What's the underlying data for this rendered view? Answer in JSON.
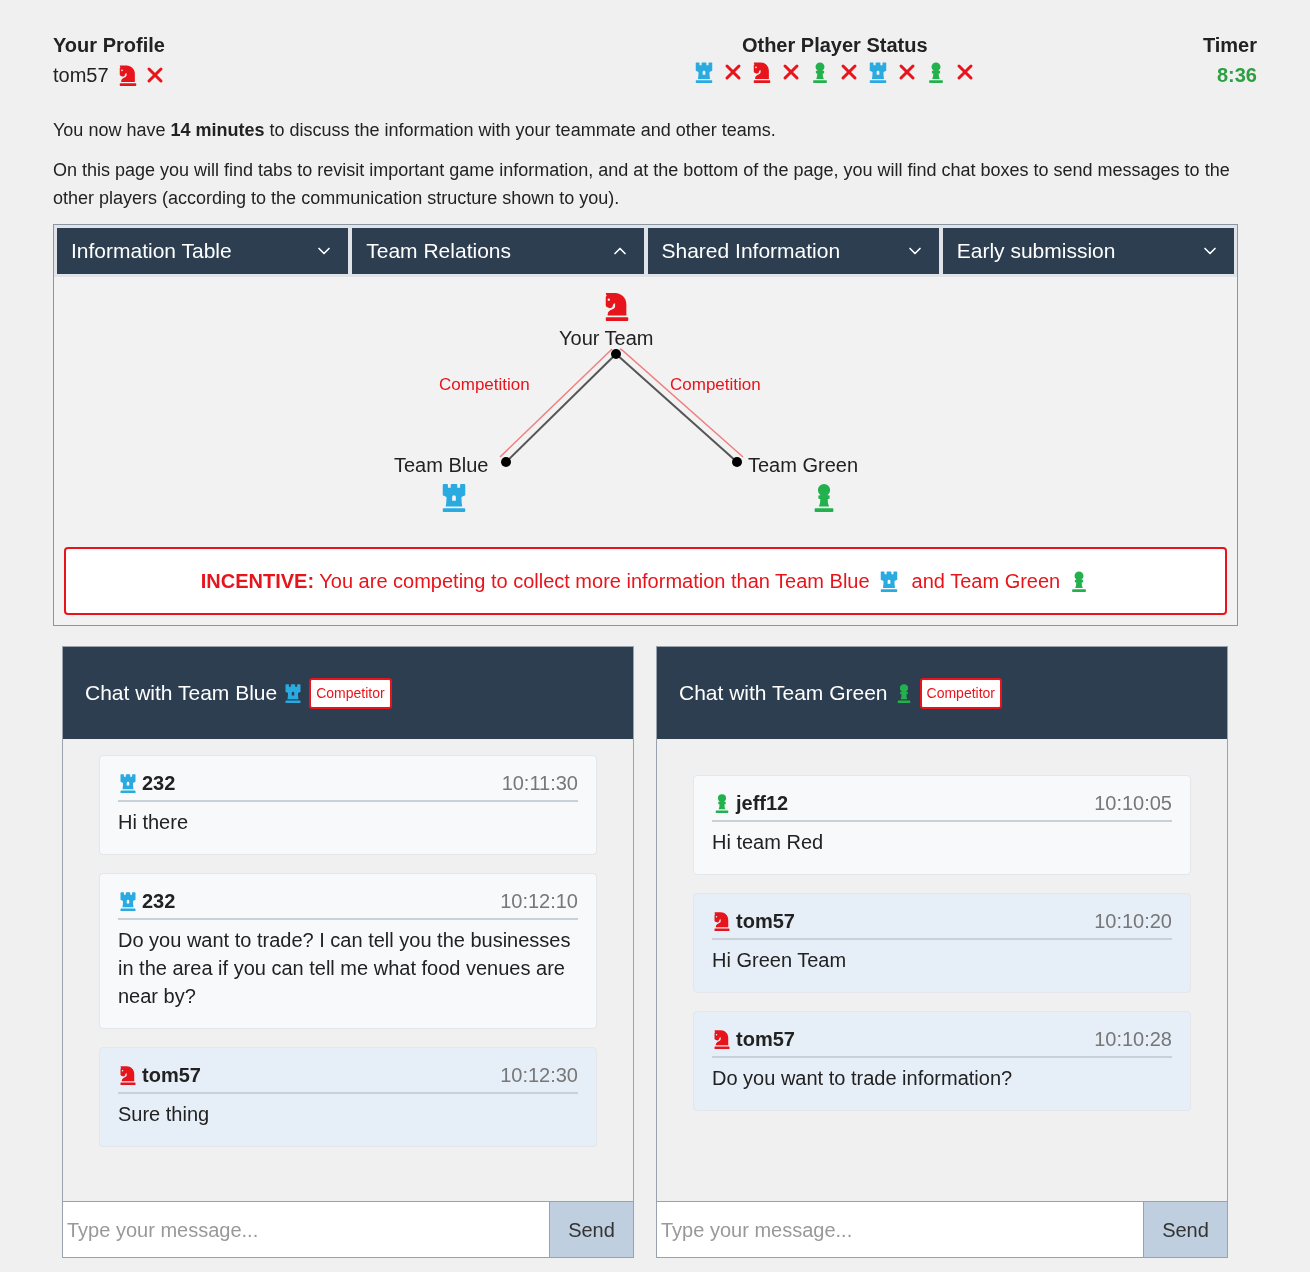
{
  "profile": {
    "title": "Your Profile",
    "name": "tom57",
    "kind": "knight",
    "color": "#e8141c",
    "ready": false
  },
  "other_status": {
    "title": "Other Player Status",
    "players": [
      {
        "kind": "rook",
        "color": "#29abe2",
        "ready": false
      },
      {
        "kind": "knight",
        "color": "#e8141c",
        "ready": false
      },
      {
        "kind": "pawn",
        "color": "#22b14c",
        "ready": false
      },
      {
        "kind": "rook",
        "color": "#29abe2",
        "ready": false
      },
      {
        "kind": "pawn",
        "color": "#22b14c",
        "ready": false
      }
    ]
  },
  "timer": {
    "title": "Timer",
    "value": "8:36"
  },
  "intro": [
    "You now have **14 minutes** to discuss the information with your teammate and other teams.",
    "On this page you will find tabs to revisit important game information, and at the bottom of the page, you will find chat boxes to send messages to the other players (according to the communication structure shown to you)."
  ],
  "tabs": [
    {
      "label": "Information Table",
      "expanded": false
    },
    {
      "label": "Team Relations",
      "expanded": true
    },
    {
      "label": "Shared Information",
      "expanded": false
    },
    {
      "label": "Early submission",
      "expanded": false
    }
  ],
  "relations": {
    "center": {
      "label": "Your Team",
      "kind": "knight",
      "color": "#e8141c"
    },
    "left": {
      "label": "Team Blue",
      "kind": "rook",
      "color": "#29abe2",
      "relation": "Competition"
    },
    "right": {
      "label": "Team Green",
      "kind": "pawn",
      "color": "#22b14c",
      "relation": "Competition"
    }
  },
  "incentive": {
    "text": "**INCENTIVE:** You are competing to collect more information than Team Blue",
    "text_2": "and Team Green"
  },
  "chats": [
    {
      "title": "Chat with Team Blue",
      "kind": "rook",
      "color": "#29abe2",
      "badge": "Competitor",
      "placeholder": "Type your message...",
      "send": "Send",
      "messages": [
        {
          "user": "232",
          "time": "10:11:30",
          "text": "Hi there",
          "own": false,
          "kind": "rook",
          "color": "#29abe2"
        },
        {
          "user": "232",
          "time": "10:12:10",
          "text": "Do you want to trade? I can tell you the businesses in the area if you can tell me what food venues are near by?",
          "own": false,
          "kind": "rook",
          "color": "#29abe2"
        },
        {
          "user": "tom57",
          "time": "10:12:30",
          "text": "Sure thing",
          "own": true,
          "kind": "knight",
          "color": "#e8141c"
        }
      ]
    },
    {
      "title": "Chat with Team Green",
      "kind": "pawn",
      "color": "#22b14c",
      "badge": "Competitor",
      "placeholder": "Type your message...",
      "send": "Send",
      "messages": [
        {
          "user": "jeff12",
          "time": "10:10:05",
          "text": "Hi team Red",
          "own": false,
          "kind": "pawn",
          "color": "#22b14c"
        },
        {
          "user": "tom57",
          "time": "10:10:20",
          "text": "Hi Green Team",
          "own": true,
          "kind": "knight",
          "color": "#e8141c"
        },
        {
          "user": "tom57",
          "time": "10:10:28",
          "text": "Do you want to trade information?",
          "own": true,
          "kind": "knight",
          "color": "#e8141c"
        }
      ]
    }
  ]
}
